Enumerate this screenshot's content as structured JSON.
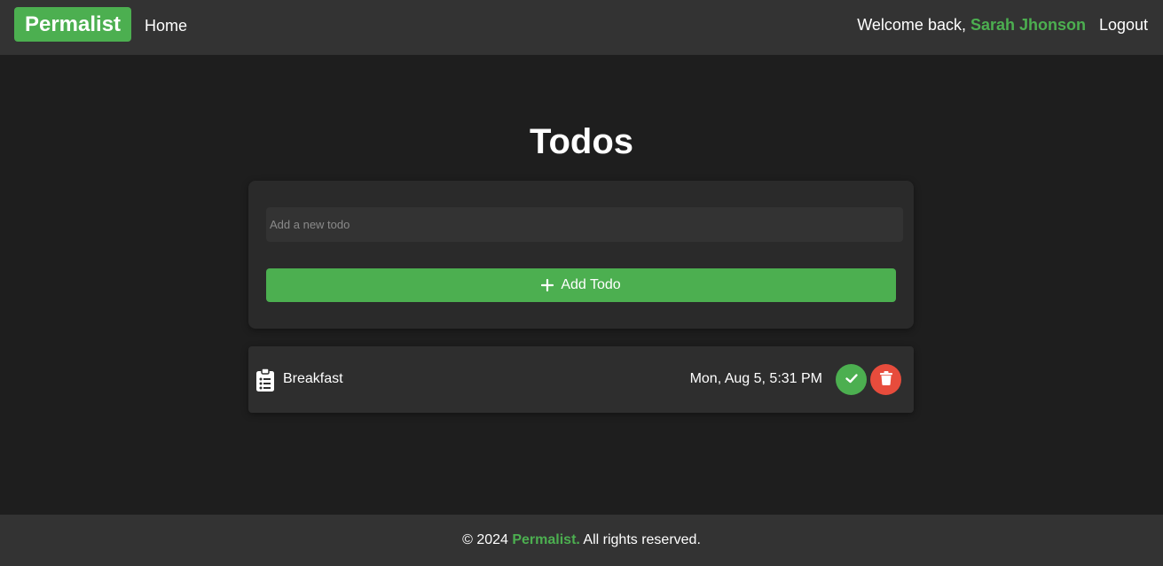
{
  "navbar": {
    "brand": "Permalist",
    "home_label": "Home",
    "welcome_prefix": "Welcome back, ",
    "user_name": "Sarah Jhonson",
    "logout_label": "Logout"
  },
  "main": {
    "title": "Todos",
    "input_placeholder": "Add a new todo",
    "input_value": "",
    "add_button_label": "Add Todo",
    "todos": [
      {
        "text": "Breakfast",
        "date": "Mon, Aug 5, 5:31 PM",
        "icon": "clipboard-list-icon"
      }
    ]
  },
  "footer": {
    "prefix": "© 2024 ",
    "brand": "Permalist.",
    "suffix": " All rights reserved."
  },
  "colors": {
    "accent": "#4caf50",
    "danger": "#e74c3c",
    "background": "#1e1e1e",
    "bar": "#333333"
  }
}
